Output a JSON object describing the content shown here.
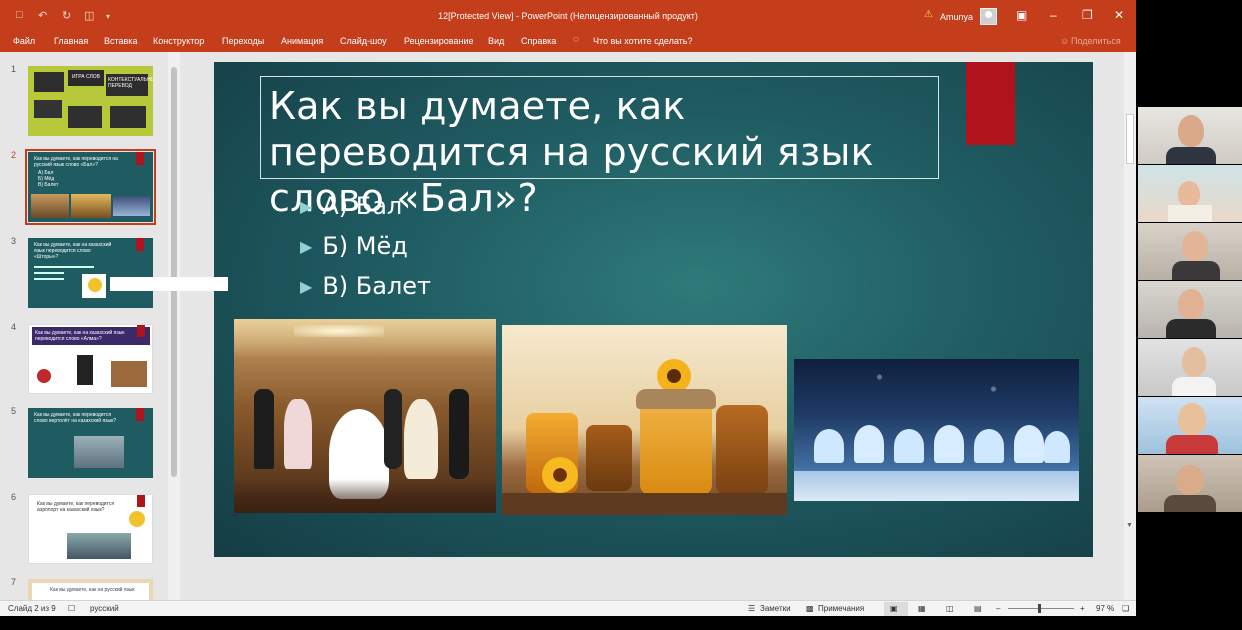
{
  "window": {
    "title": "12[Protected View]  -  PowerPoint (Нелицензированный продукт)",
    "user": "Amunya",
    "warning_icon": "warning-icon",
    "controls": [
      "restore-ribbon-icon",
      "minimize-icon",
      "maximize-icon",
      "close-icon"
    ]
  },
  "ribbon": {
    "tabs": [
      "Файл",
      "Главная",
      "Вставка",
      "Конструктор",
      "Переходы",
      "Анимация",
      "Слайд-шоу",
      "Рецензирование",
      "Вид",
      "Справка"
    ],
    "tell_me": "Что вы хотите сделать?",
    "share": "Поделиться"
  },
  "thumbnails": [
    {
      "num": "1",
      "lines": [
        "ИГРА СЛОВ",
        "КОНТЕКСТУАЛЬНЫЙ ПЕРЕВОД"
      ]
    },
    {
      "num": "2",
      "lines": [
        "Как вы думаете, как переводится на русский язык слово «Бал»?",
        "А) Бал",
        "Б) Мёд",
        "В) Балет"
      ]
    },
    {
      "num": "3",
      "lines": [
        "Как вы думаете, как на казахский язык переводится слово «Шторы»?"
      ]
    },
    {
      "num": "4",
      "lines": [
        "Как вы думаете, как на казахский язык переводится слово «Алма»?"
      ]
    },
    {
      "num": "5",
      "lines": [
        "Как вы думаете, как переводится слово вертолёт на казахский язык?"
      ]
    },
    {
      "num": "6",
      "lines": [
        "Как вы думаете, как переводится аэропорт на казахский язык?"
      ]
    },
    {
      "num": "7",
      "lines": [
        "Как вы думаете, как на русский язык"
      ]
    }
  ],
  "slide": {
    "title": "Как вы думаете, как переводится на русский язык слово «Бал»?",
    "bullets": [
      "А) Бал",
      "Б) Мёд",
      "В) Балет"
    ],
    "images": [
      "ballroom-dance-image",
      "honey-jars-image",
      "ballet-image"
    ]
  },
  "statusbar": {
    "slide_info": "Слайд 2 из 9",
    "language": "русский",
    "notes": "Заметки",
    "comments": "Примечания",
    "zoom": "97 %"
  },
  "colors": {
    "accent": "#c43e1c",
    "slide_bg": "#1f5c62",
    "red_tab": "#b0131c"
  }
}
